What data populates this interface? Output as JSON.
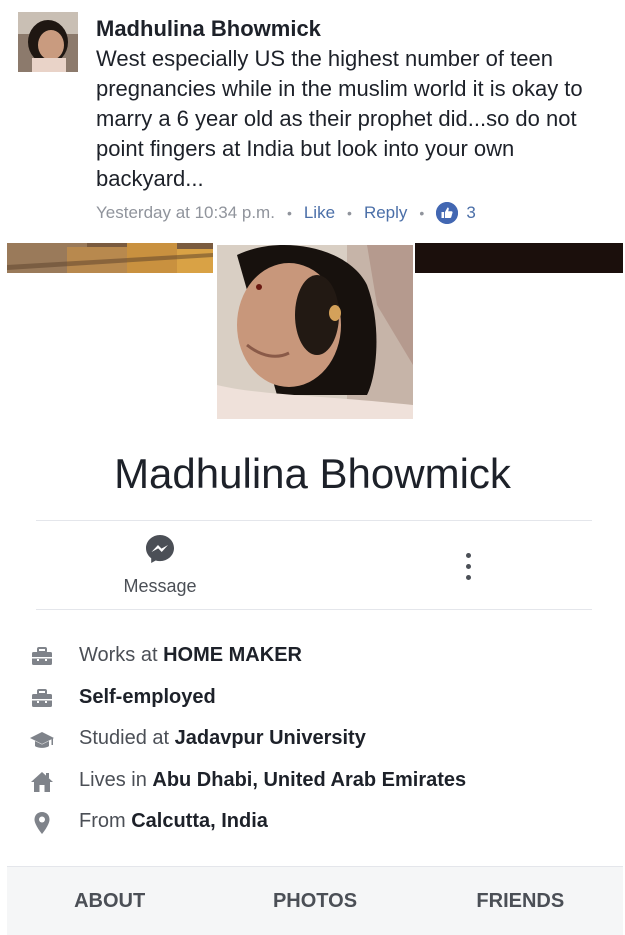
{
  "comment": {
    "author": "Madhulina Bhowmick",
    "text": "West especially US the highest  number of teen pregnancies while in the muslim world it is okay to marry a 6 year old as their prophet did...so do not point fingers at India but look into your own backyard...",
    "timestamp": "Yesterday at 10:34 p.m.",
    "like_label": "Like",
    "reply_label": "Reply",
    "like_count": "3",
    "separator": "•"
  },
  "profile": {
    "name": "Madhulina Bhowmick",
    "message_label": "Message",
    "info": [
      {
        "icon": "briefcase-icon",
        "prefix": "Works at ",
        "value": "HOME MAKER"
      },
      {
        "icon": "briefcase-icon",
        "prefix": "",
        "value": "Self-employed"
      },
      {
        "icon": "graduation-cap-icon",
        "prefix": "Studied at ",
        "value": "Jadavpur University"
      },
      {
        "icon": "home-icon",
        "prefix": "Lives in ",
        "value": "Abu Dhabi, United Arab Emirates"
      },
      {
        "icon": "location-pin-icon",
        "prefix": "From ",
        "value": "Calcutta, India"
      }
    ]
  },
  "tabs": [
    {
      "label": "ABOUT"
    },
    {
      "label": "PHOTOS"
    },
    {
      "label": "FRIENDS"
    }
  ],
  "colors": {
    "accent": "#4267b2",
    "link": "#4b6fa8",
    "text": "#1d2129",
    "secondary_text": "#4b4f56",
    "meta_text": "#90949c"
  }
}
